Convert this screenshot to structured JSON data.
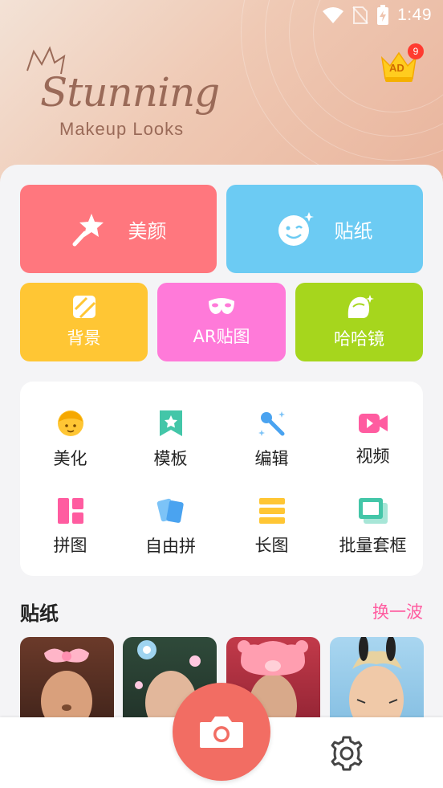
{
  "status_bar": {
    "time": "1:49"
  },
  "header": {
    "logo_title": "Stunning",
    "logo_subtitle": "Makeup Looks",
    "ad_label": "AD",
    "ad_badge_count": "9"
  },
  "main_tiles": [
    {
      "label": "美颜",
      "icon": "magic-wand-star-icon",
      "color": "#ff777e"
    },
    {
      "label": "贴纸",
      "icon": "wink-face-icon",
      "color": "#6ccbf3"
    }
  ],
  "secondary_tiles": [
    {
      "label": "背景",
      "icon": "background-stripes-icon",
      "color": "#ffc634"
    },
    {
      "label": "AR贴图",
      "icon": "mask-icon",
      "color": "#ff7ad9"
    },
    {
      "label": "哈哈镜",
      "icon": "funhouse-mirror-face-icon",
      "color": "#a6d61d"
    }
  ],
  "tools": [
    {
      "label": "美化",
      "icon": "beautify-face-icon"
    },
    {
      "label": "模板",
      "icon": "template-bookmark-icon"
    },
    {
      "label": "编辑",
      "icon": "edit-brush-icon"
    },
    {
      "label": "视频",
      "icon": "video-camera-icon"
    },
    {
      "label": "拼图",
      "icon": "collage-grid-icon"
    },
    {
      "label": "自由拼",
      "icon": "free-collage-cards-icon"
    },
    {
      "label": "长图",
      "icon": "long-image-icon"
    },
    {
      "label": "批量套框",
      "icon": "batch-frame-icon"
    }
  ],
  "sticker_section": {
    "title": "贴纸",
    "refresh_label": "换一波"
  },
  "bottom_bar": {
    "camera_icon": "camera-icon",
    "settings_icon": "gear-icon"
  }
}
